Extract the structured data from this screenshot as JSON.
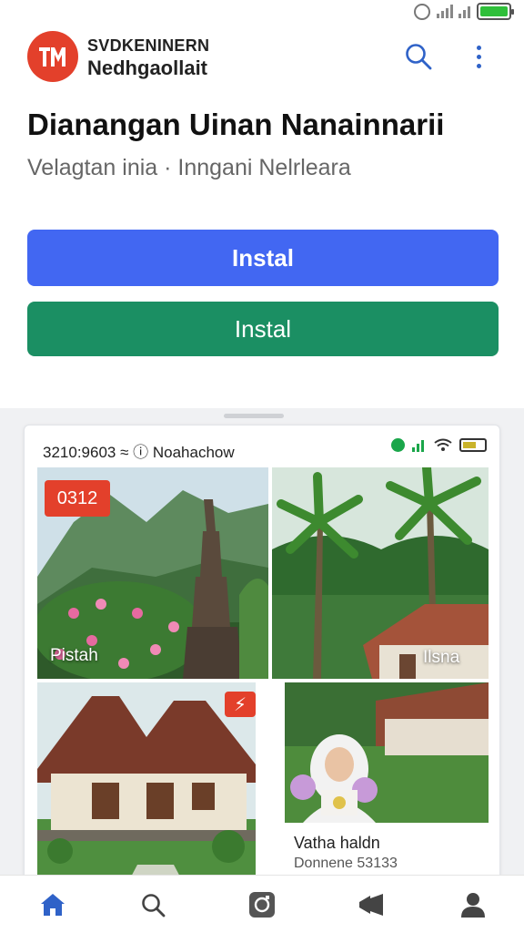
{
  "app": {
    "brand_top": "SVDKENINERN",
    "brand_bottom": "Nedhgaollait"
  },
  "title": "Dianangan Uinan Nanainnarii",
  "subtitle": "Velagtan inia · Inngani Nelrleara",
  "buttons": {
    "primary_label": "Instal",
    "secondary_label": "Instal"
  },
  "preview": {
    "status_text": "3210:9603 ≈ ⓘ Noahachow",
    "tiles": [
      {
        "badge": "0312",
        "label": "Pistah"
      },
      {
        "label": "Ilsna"
      },
      {
        "badge": "⚡"
      }
    ],
    "caption_title": "Vatha haldn",
    "caption_sub": "Donnene 53133"
  },
  "nav": [
    "home-icon",
    "search-icon",
    "camera-icon",
    "megaphone-icon",
    "profile-icon"
  ],
  "colors": {
    "brand_red": "#e3402b",
    "primary_blue": "#4267f2",
    "secondary_green": "#1b8f63",
    "nav_active": "#2f62c8"
  }
}
